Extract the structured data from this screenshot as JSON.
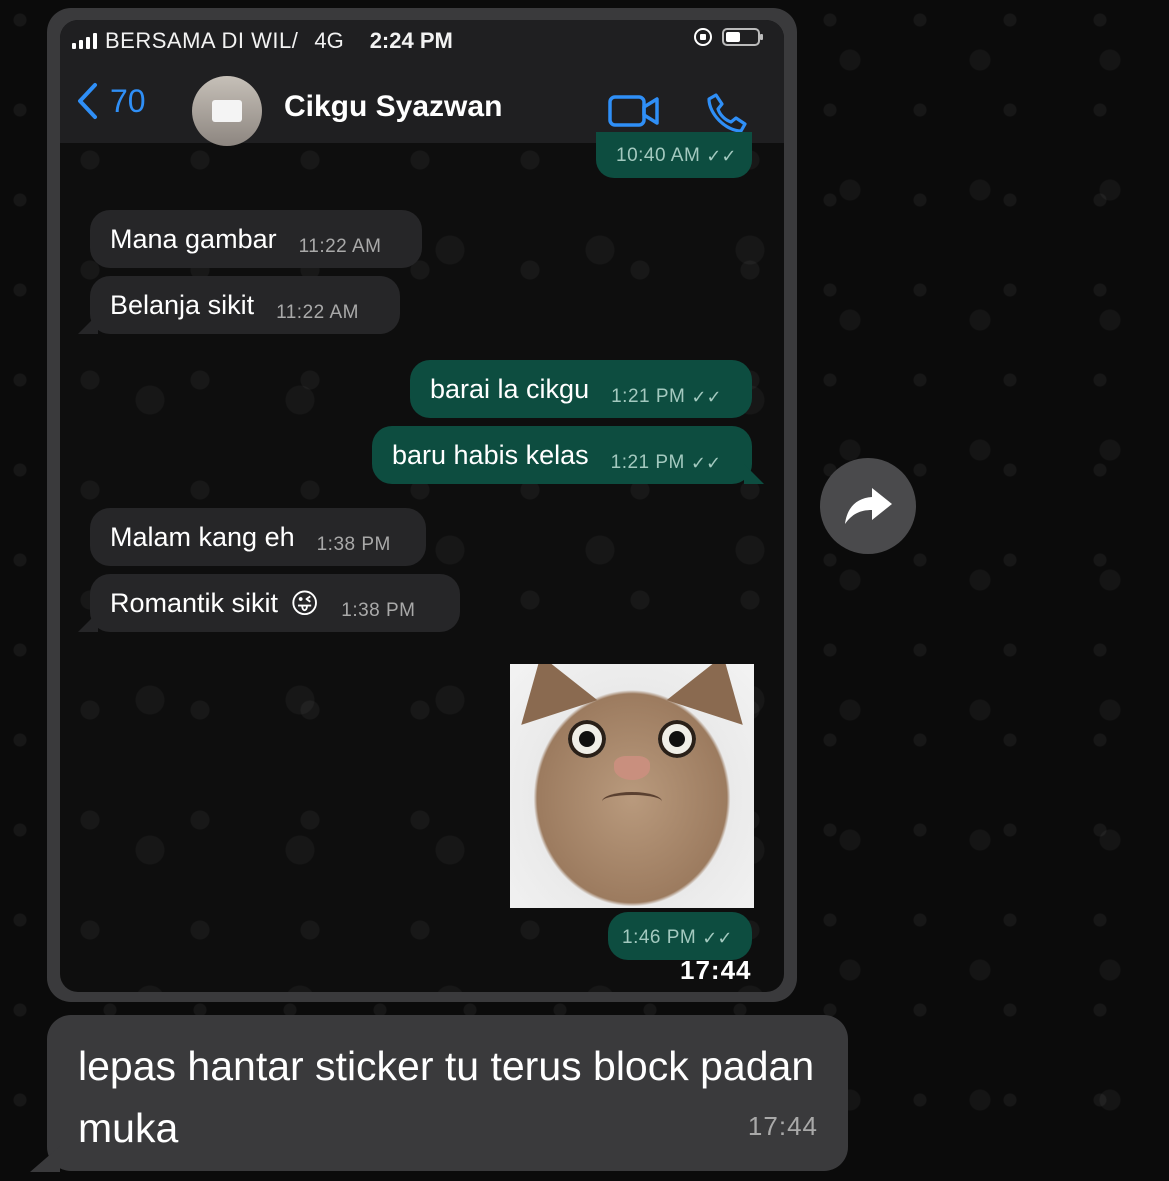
{
  "status_bar": {
    "carrier": "BERSAMA DI WIL/",
    "network": "4G",
    "time": "2:24 PM"
  },
  "chat_header": {
    "back_count": "70",
    "contact_name": "Cikgu Syazwan",
    "icons": [
      "chevron-left-icon",
      "video-camera-icon",
      "phone-icon"
    ],
    "accent_color": "#2f8ff7"
  },
  "messages": [
    {
      "direction": "out",
      "text": "",
      "time": "10:40 AM"
    },
    {
      "direction": "in",
      "text": "Mana gambar",
      "time": "11:22 AM"
    },
    {
      "direction": "in",
      "text": "Belanja sikit",
      "time": "11:22 AM"
    },
    {
      "direction": "out",
      "text": "barai la cikgu",
      "time": "1:21 PM"
    },
    {
      "direction": "out",
      "text": "baru habis kelas",
      "time": "1:21 PM"
    },
    {
      "direction": "in",
      "text": "Malam kang eh",
      "time": "1:38 PM"
    },
    {
      "direction": "in",
      "text": "Romantik sikit",
      "emoji": "😜",
      "time": "1:38 PM"
    },
    {
      "direction": "out",
      "text": "",
      "type": "sticker",
      "time": "1:46 PM"
    }
  ],
  "screenshot_overlay_time": "17:44",
  "caption": {
    "text": "lepas hantar sticker tu terus block padan muka",
    "time": "17:44"
  },
  "colors": {
    "incoming_bubble": "#262628",
    "outgoing_bubble": "#0d4d40",
    "outer_bubble": "#3a3a3c"
  }
}
